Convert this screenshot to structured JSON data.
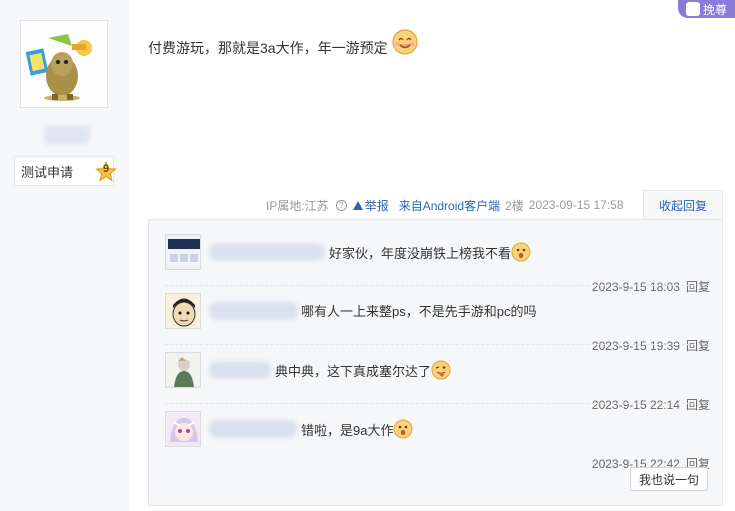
{
  "post": {
    "text": "付费游玩，那就是3a大作，年一游预定",
    "emoji": "smile-emoji"
  },
  "author": {
    "level_title": "测试申请",
    "level": "9"
  },
  "top_button": {
    "label": "挽尊",
    "icon": "hand-icon"
  },
  "meta": {
    "ip_location": "IP属地:江苏",
    "report_label": "举报",
    "client": "来自Android客户端",
    "floor": "2楼",
    "time": "2023-09-15 17:58",
    "collapse_label": "收起回复"
  },
  "replies": [
    {
      "content": "好家伙，年度没崩铁上榜我不看",
      "emoji": "surprised-emoji",
      "time": "2023-9-15 18:03",
      "reply_label": "回复"
    },
    {
      "content": "哪有人一上来整ps，不是先手游和pc的吗",
      "emoji": "",
      "time": "2023-9-15 19:39",
      "reply_label": "回复"
    },
    {
      "content": "典中典，这下真成塞尔达了",
      "emoji": "tongue-emoji",
      "time": "2023-9-15 22:14",
      "reply_label": "回复"
    },
    {
      "content": "错啦，是9a大作",
      "emoji": "surprised-emoji",
      "time": "2023-9-15 22:42",
      "reply_label": "回复"
    }
  ],
  "say_button": "我也说一句",
  "colors": {
    "link": "#2d64b3",
    "badge": "#8a7bd8",
    "panel": "#f6f7f9"
  }
}
